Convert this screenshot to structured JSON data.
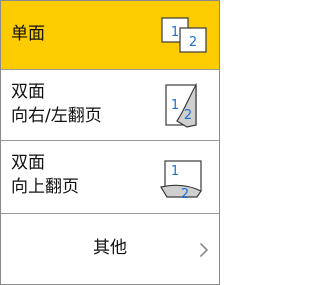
{
  "options": [
    {
      "label": "单面",
      "selected": true,
      "icon": "one-sided-icon"
    },
    {
      "line1": "双面",
      "line2": "向右/左翻页",
      "selected": false,
      "icon": "two-sided-long-edge-icon"
    },
    {
      "line1": "双面",
      "line2": "向上翻页",
      "selected": false,
      "icon": "two-sided-short-edge-icon"
    }
  ],
  "more": {
    "label": "其他",
    "icon": "chevron-right-icon"
  },
  "icon_digits": {
    "front": "1",
    "back": "2"
  },
  "colors": {
    "selected_background": "#fccb00",
    "digit_blue": "#1f6fd2",
    "divider": "#9a9a9a"
  }
}
